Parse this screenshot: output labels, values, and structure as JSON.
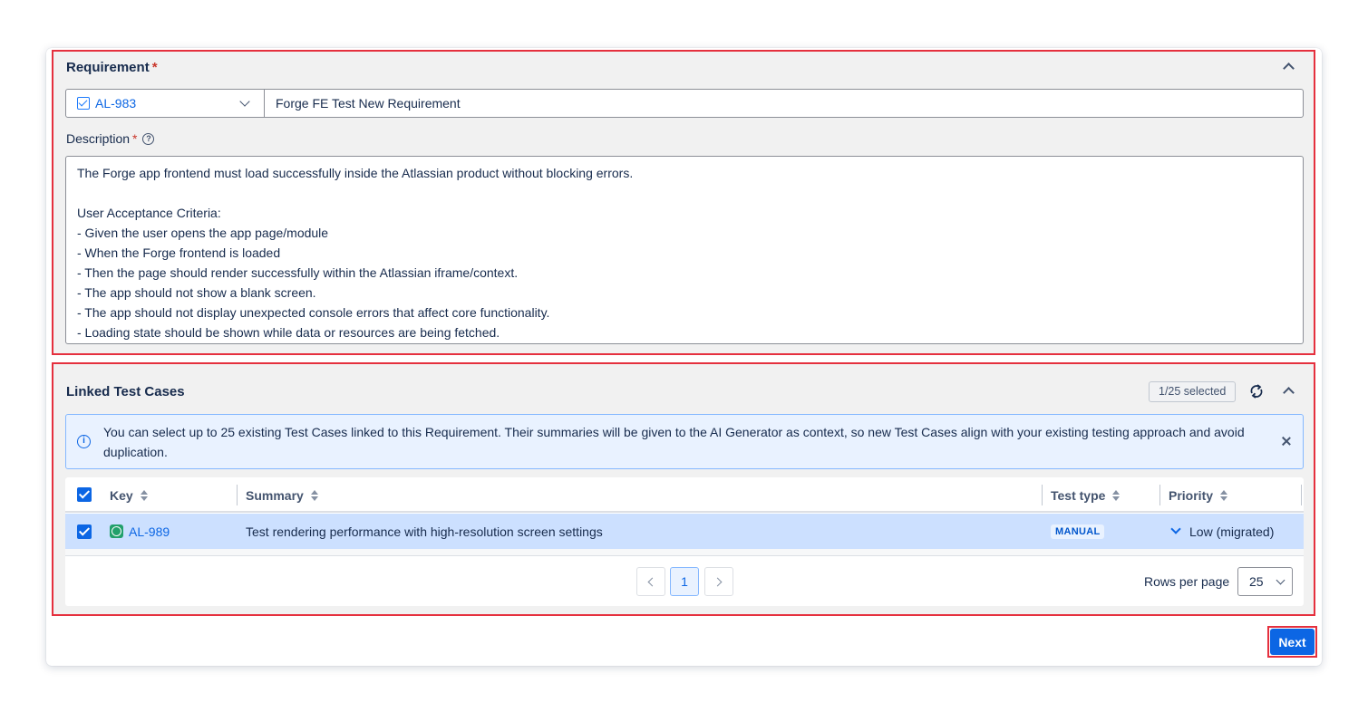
{
  "requirement": {
    "title": "Requirement",
    "required_mark": "*",
    "key": "AL-983",
    "summary": "Forge FE Test New Requirement",
    "description_label": "Description",
    "description_required_mark": "*",
    "help_glyph": "?",
    "description_lines": [
      "The Forge app frontend must load successfully inside the Atlassian product without blocking errors.",
      "",
      "User Acceptance Criteria:",
      "- Given the user opens the app page/module",
      "- When the Forge frontend is loaded",
      "- Then the page should render successfully within the Atlassian iframe/context.",
      "- The app should not show a blank screen.",
      "- The app should not display unexpected console errors that affect core functionality.",
      "- Loading state should be shown while data or resources are being fetched."
    ]
  },
  "linked_test_cases": {
    "title": "Linked Test Cases",
    "selected_badge": "1/25 selected",
    "info_glyph": "i",
    "info_message": "You can select up to 25 existing Test Cases linked to this Requirement. Their summaries will be given to the AI Generator as context, so new Test Cases align with your existing testing approach and avoid duplication.",
    "columns": {
      "key": "Key",
      "summary": "Summary",
      "test_type": "Test type",
      "priority": "Priority"
    },
    "rows": [
      {
        "key": "AL-989",
        "summary": "Test rendering performance with high-resolution screen settings",
        "test_type": "MANUAL",
        "priority": "Low (migrated)"
      }
    ],
    "pagination": {
      "current_page": "1",
      "rows_per_page_label": "Rows per page",
      "rows_per_page": "25"
    }
  },
  "footer": {
    "next_label": "Next"
  },
  "colors": {
    "primary": "#0c66e4",
    "highlight_border": "#e5303e",
    "section_bg": "#f1f1f1",
    "selected_row": "#cce0ff",
    "info_bg": "#e9f2ff"
  }
}
